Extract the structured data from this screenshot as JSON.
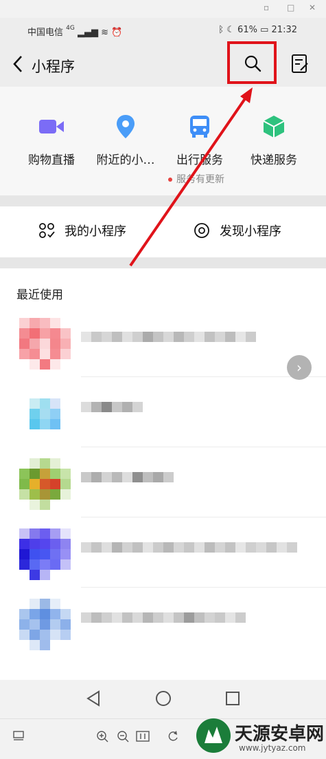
{
  "status_bar": {
    "carrier": "中国电信",
    "network": "4G",
    "battery": "61%",
    "time": "21:32"
  },
  "header": {
    "back_icon": "chevron-left-icon",
    "title": "小程序",
    "search_icon": "search-icon",
    "notes_icon": "list-edit-icon",
    "highlight_color": "#e0131a"
  },
  "services": {
    "items": [
      {
        "label": "购物直播",
        "icon": "video-camera-icon",
        "color": "#7b6cf6"
      },
      {
        "label": "附近的小…",
        "icon": "location-pin-icon",
        "color": "#4a9df8"
      },
      {
        "label": "出行服务",
        "icon": "bus-icon",
        "color": "#3e8ef7"
      },
      {
        "label": "快递服务",
        "icon": "package-box-icon",
        "color": "#2ec27e"
      }
    ],
    "update_note": "服务有更新"
  },
  "quick_links": {
    "mine": "我的小程序",
    "discover": "发现小程序"
  },
  "recent": {
    "heading": "最近使用"
  },
  "colors": {
    "accent_red": "#e0131a",
    "background": "#ededed"
  }
}
